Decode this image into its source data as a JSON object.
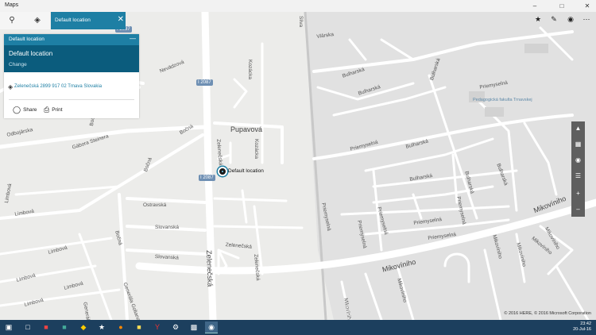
{
  "window": {
    "title": "Maps"
  },
  "toolbar": {
    "search_icon": "search-icon",
    "directions_icon": "directions-icon",
    "search_value": "Default location"
  },
  "panel": {
    "header": "Default location",
    "title": "Default location",
    "change": "Change",
    "address": "Zelenečská 2899 917 02 Trnava Slovakia",
    "share": "Share",
    "print": "Print"
  },
  "map": {
    "marker_label": "Default location",
    "copyright": "© 2016 HERE, © 2016 Microsoft Corporation",
    "road_shields": [
      "I 2087",
      "I 2087",
      "I 2087"
    ],
    "streets": [
      "Vlárska",
      "Nevädzová",
      "Bulharská",
      "Bulharská",
      "Bulharská",
      "Bulharská",
      "Bulharská",
      "Bulharská",
      "Bulharská",
      "Pedagogická fakulta Trnavskej",
      "Priemyselná",
      "Priemyselná",
      "Priemyselná",
      "Priemyselná",
      "Priemyselná",
      "Priemyselná",
      "Priemyselná",
      "Priemyselná",
      "Odbojárska",
      "Gábora Steinera",
      "Bočná",
      "Pupavová",
      "Kozácka",
      "Kozácka",
      "Zelenečská",
      "Zelenečská",
      "Zelenečská",
      "Zelenečská",
      "Bočná",
      "Ostravská",
      "Slovanská",
      "Slovanská",
      "Limbová",
      "Limbová",
      "Limbová",
      "Limbová",
      "Limbová",
      "Limbová",
      "Generála Goliana",
      "Generála Goliana",
      "Bočná",
      "Mikovíniho",
      "Mikovíniho",
      "Mikovíniho",
      "Mikovíniho",
      "Mikovíniho",
      "Mikovíniho",
      "Mikovíniho",
      "Mikovíniho",
      "Bočná",
      "Sliva"
    ]
  },
  "right_controls": [
    "compass-icon",
    "3d-cities-icon",
    "locate-icon",
    "layers-icon",
    "zoom-in-icon",
    "zoom-out-icon"
  ],
  "top_right": [
    "favorites-icon",
    "ink-icon",
    "traffic-icon",
    "more-icon"
  ],
  "taskbar": {
    "time": "23:42",
    "date": "20-Jul-16"
  },
  "colors": {
    "accent": "#1e7fa4",
    "panel_band": "#0b5c7d",
    "taskbar": "#1c3f5e"
  }
}
